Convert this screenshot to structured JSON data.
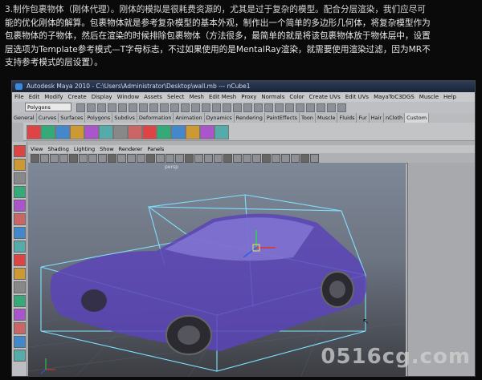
{
  "article": {
    "lines": [
      "3.制作包裹物体（刚体代理）。刚体的模拟是很耗费资源的，尤其是过于复杂的模型。配合分层渲染，我们应尽可",
      "能的优化刚体的解算。包裹物体就是参考复杂模型的基本外观，制作出一个简单的多边形几何体，将复杂模型作为",
      "包裹物体的子物体，然后在渲染的时候排除包裹物体（方法很多，最简单的就是将该包裹物体放于物体层中，设置",
      "层选项为Template参考模式—T字母标志，不过如果使用的是MentalRay渲染，就需要使用渲染过滤，因为MR不",
      "支持参考模式的层设置）。"
    ]
  },
  "maya": {
    "window_title": "Autodesk Maya 2010 - C:\\Users\\Administrator\\Desktop\\wall.mb --- nCube1",
    "menus": [
      "File",
      "Edit",
      "Modify",
      "Create",
      "Display",
      "Window",
      "Assets",
      "Select",
      "Mesh",
      "Edit Mesh",
      "Proxy",
      "Normals",
      "Color",
      "Create UVs",
      "Edit UVs",
      "MayaToC3DGS",
      "Muscle",
      "Help"
    ],
    "mode_selector": "Polygons",
    "shelf_tabs": [
      "General",
      "Curves",
      "Surfaces",
      "Polygons",
      "Subdivs",
      "Deformation",
      "Animation",
      "Dynamics",
      "Rendering",
      "PaintEffects",
      "Toon",
      "Muscle",
      "Fluids",
      "Fur",
      "Hair",
      "nCloth",
      "Custom"
    ],
    "active_shelf_tab": "Custom",
    "panel_menus": [
      "View",
      "Shading",
      "Lighting",
      "Show",
      "Renderer",
      "Panels"
    ],
    "viewport_label": "persp",
    "colors": {
      "car_body": "#5a44b8",
      "wireframe": "#7ee0ff",
      "viewport_top": "#7e8897",
      "viewport_bottom": "#3b3d42"
    }
  },
  "watermark": "0516cg.com"
}
